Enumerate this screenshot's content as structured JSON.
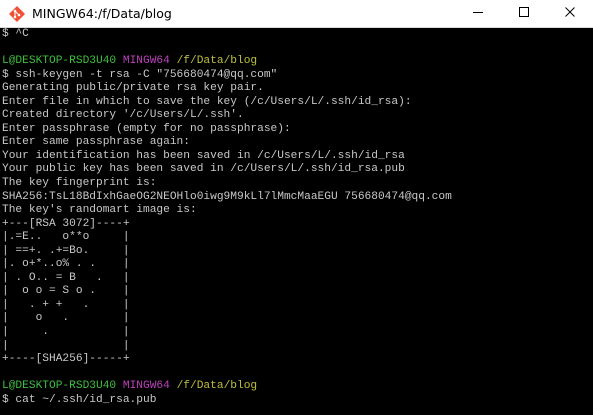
{
  "window": {
    "title": "MINGW64:/f/Data/blog",
    "icon": "git-bash-icon",
    "controls": {
      "minimize_icon": "minimize-icon",
      "maximize_icon": "maximize-icon",
      "close_icon": "close-icon"
    }
  },
  "colors": {
    "background": "#000000",
    "text": "#c8c8c8",
    "prompt_user": "#3fbf3f",
    "prompt_system": "#bf3fbf",
    "prompt_path": "#bfbf3f",
    "titlebar": "#ffffff"
  },
  "terminal": {
    "lines": [
      [
        {
          "t": "$ ^C",
          "c": "plain"
        }
      ],
      [
        {
          "t": "",
          "c": "plain"
        }
      ],
      [
        {
          "t": "L@DESKTOP-RSD3U40",
          "c": "user"
        },
        {
          "t": " ",
          "c": "plain"
        },
        {
          "t": "MINGW64",
          "c": "sys"
        },
        {
          "t": " ",
          "c": "plain"
        },
        {
          "t": "/f/Data/blog",
          "c": "path"
        }
      ],
      [
        {
          "t": "$ ssh-keygen -t rsa -C \"756680474@qq.com\"",
          "c": "plain"
        }
      ],
      [
        {
          "t": "Generating public/private rsa key pair.",
          "c": "plain"
        }
      ],
      [
        {
          "t": "Enter file in which to save the key (/c/Users/L/.ssh/id_rsa):",
          "c": "plain"
        }
      ],
      [
        {
          "t": "Created directory '/c/Users/L/.ssh'.",
          "c": "plain"
        }
      ],
      [
        {
          "t": "Enter passphrase (empty for no passphrase):",
          "c": "plain"
        }
      ],
      [
        {
          "t": "Enter same passphrase again:",
          "c": "plain"
        }
      ],
      [
        {
          "t": "Your identification has been saved in /c/Users/L/.ssh/id_rsa",
          "c": "plain"
        }
      ],
      [
        {
          "t": "Your public key has been saved in /c/Users/L/.ssh/id_rsa.pub",
          "c": "plain"
        }
      ],
      [
        {
          "t": "The key fingerprint is:",
          "c": "plain"
        }
      ],
      [
        {
          "t": "SHA256:TsL18BdIxhGaeOG2NEOHlo0iwg9M9kLl7lMmcMaaEGU 756680474@qq.com",
          "c": "plain"
        }
      ],
      [
        {
          "t": "The key's randomart image is:",
          "c": "plain"
        }
      ],
      [
        {
          "t": "+---[RSA 3072]----+",
          "c": "plain"
        }
      ],
      [
        {
          "t": "|.=E..   o**o     |",
          "c": "plain"
        }
      ],
      [
        {
          "t": "| ==+. .+=Bo.     |",
          "c": "plain"
        }
      ],
      [
        {
          "t": "|. o+*..o% . .    |",
          "c": "plain"
        }
      ],
      [
        {
          "t": "| . O.. = B   .   |",
          "c": "plain"
        }
      ],
      [
        {
          "t": "|  o o = S o .    |",
          "c": "plain"
        }
      ],
      [
        {
          "t": "|   . + +   .     |",
          "c": "plain"
        }
      ],
      [
        {
          "t": "|    o   .        |",
          "c": "plain"
        }
      ],
      [
        {
          "t": "|     .           |",
          "c": "plain"
        }
      ],
      [
        {
          "t": "|                 |",
          "c": "plain"
        }
      ],
      [
        {
          "t": "+----[SHA256]-----+",
          "c": "plain"
        }
      ],
      [
        {
          "t": "",
          "c": "plain"
        }
      ],
      [
        {
          "t": "L@DESKTOP-RSD3U40",
          "c": "user"
        },
        {
          "t": " ",
          "c": "plain"
        },
        {
          "t": "MINGW64",
          "c": "sys"
        },
        {
          "t": " ",
          "c": "plain"
        },
        {
          "t": "/f/Data/blog",
          "c": "path"
        }
      ],
      [
        {
          "t": "$ cat ~/.ssh/id_rsa.pub",
          "c": "plain"
        }
      ]
    ]
  }
}
